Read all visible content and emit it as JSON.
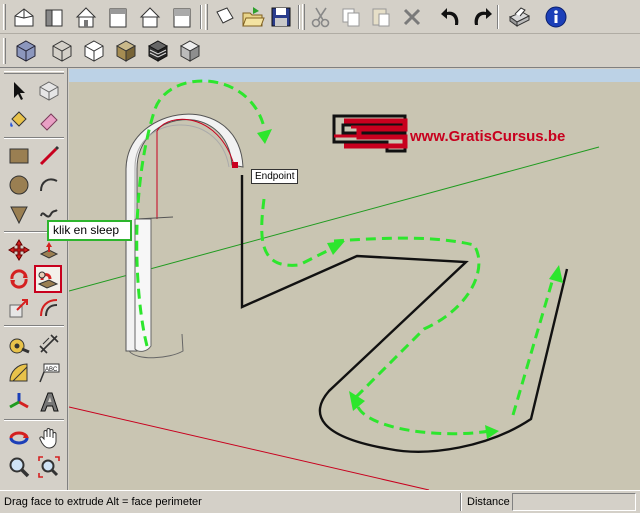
{
  "toolbar": {
    "top_row": [
      {
        "name": "iso-view-icon"
      },
      {
        "name": "top-view-icon"
      },
      {
        "name": "front-view-icon"
      },
      {
        "name": "right-view-icon"
      },
      {
        "name": "back-view-icon"
      },
      {
        "name": "left-view-icon"
      },
      {
        "name": "new-file-icon"
      },
      {
        "name": "open-file-icon"
      },
      {
        "name": "save-icon"
      },
      {
        "name": "cut-icon"
      },
      {
        "name": "copy-icon"
      },
      {
        "name": "paste-icon"
      },
      {
        "name": "erase-icon"
      },
      {
        "name": "undo-icon"
      },
      {
        "name": "redo-icon"
      },
      {
        "name": "print-icon"
      },
      {
        "name": "info-icon"
      }
    ],
    "second_row": [
      {
        "name": "xray-style-icon"
      },
      {
        "name": "wireframe-style-icon"
      },
      {
        "name": "hidden-line-style-icon"
      },
      {
        "name": "shaded-style-icon"
      },
      {
        "name": "shaded-texture-style-icon"
      },
      {
        "name": "monochrome-style-icon"
      }
    ]
  },
  "palette": {
    "tools": [
      "select-icon",
      "make-component-icon",
      "paint-bucket-icon",
      "eraser-icon",
      "rectangle-icon",
      "line-icon",
      "circle-icon",
      "arc-icon",
      "polygon-icon",
      "freehand-icon",
      "move-icon",
      "push-pull-icon",
      "rotate-icon",
      "follow-me-icon",
      "scale-icon",
      "offset-icon",
      "tape-measure-icon",
      "dimension-icon",
      "protractor-icon",
      "text-icon",
      "axes-icon",
      "3d-text-icon",
      "orbit-icon",
      "pan-icon",
      "zoom-icon",
      "zoom-extents-icon"
    ],
    "active_tool": "follow-me-icon"
  },
  "viewport": {
    "callout_text": "klik en sleep",
    "tooltip_text": "Endpoint",
    "watermark_text": "www.GratisCursus.be",
    "colors": {
      "green_axis": "#1f9b1f",
      "red_axis": "#c8001e",
      "ground": "#c9c5b2",
      "sky": "#bcd2e6",
      "path_arrow": "#2de62d"
    }
  },
  "status": {
    "message": "Drag face to extrude  Alt = face perimeter",
    "distance_label": "Distance",
    "distance_value": ""
  }
}
